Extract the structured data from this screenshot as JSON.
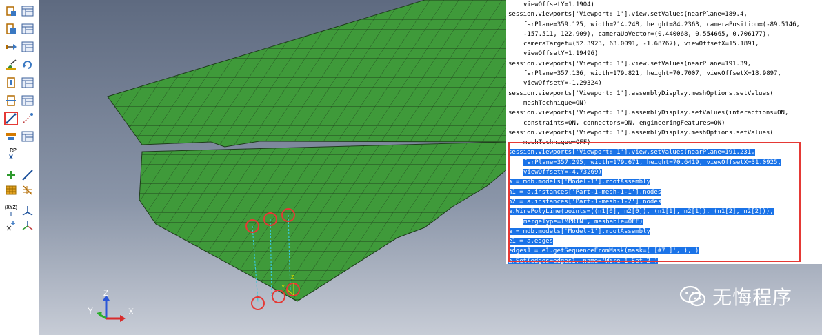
{
  "toolbox": {
    "icons": [
      "create-part-icon",
      "part-manager-icon",
      "create-instance-icon",
      "instance-manager-icon",
      "translate-instance-icon",
      "instance-manager-icon",
      "merge-cut-icon",
      "regenerate-icon",
      "feature-icon",
      "feature-manager-icon",
      "constraint-icon",
      "constraint-manager-icon",
      "create-wire-icon",
      "attachment-points-icon",
      "datum-icon",
      "datum-manager-icon",
      "reference-point-icon",
      "datum-point-icon",
      "datum-axis-icon",
      "datum-plane-icon",
      "partition-icon",
      "csys-icon",
      "datum-csys-icon",
      "mesh-edit-icon",
      "set-icon"
    ],
    "reference_point_label": "RP",
    "csys_label": "(XYZ)"
  },
  "console": {
    "lines": [
      {
        "text": "viewOffsetY=1.1904)",
        "indent": true,
        "hl": false
      },
      {
        "text": "session.viewports['Viewport: 1'].view.setValues(nearPlane=189.4,",
        "indent": false,
        "hl": false
      },
      {
        "text": "farPlane=359.125, width=214.248, height=84.2363, cameraPosition=(-89.5146,",
        "indent": true,
        "hl": false
      },
      {
        "text": "-157.511, 122.909), cameraUpVector=(0.440068, 0.554665, 0.706177),",
        "indent": true,
        "hl": false
      },
      {
        "text": "cameraTarget=(52.3923, 63.0091, -1.68767), viewOffsetX=15.1891,",
        "indent": true,
        "hl": false
      },
      {
        "text": "viewOffsetY=1.19496)",
        "indent": true,
        "hl": false
      },
      {
        "text": "session.viewports['Viewport: 1'].view.setValues(nearPlane=191.39,",
        "indent": false,
        "hl": false
      },
      {
        "text": "farPlane=357.136, width=179.821, height=70.7007, viewOffsetX=18.9897,",
        "indent": true,
        "hl": false
      },
      {
        "text": "viewOffsetY=-1.29324)",
        "indent": true,
        "hl": false
      },
      {
        "text": "session.viewports['Viewport: 1'].assemblyDisplay.meshOptions.setValues(",
        "indent": false,
        "hl": false
      },
      {
        "text": "meshTechnique=ON)",
        "indent": true,
        "hl": false
      },
      {
        "text": "session.viewports['Viewport: 1'].assemblyDisplay.setValues(interactions=ON,",
        "indent": false,
        "hl": false
      },
      {
        "text": "constraints=ON, connectors=ON, engineeringFeatures=ON)",
        "indent": true,
        "hl": false
      },
      {
        "text": "session.viewports['Viewport: 1'].assemblyDisplay.meshOptions.setValues(",
        "indent": false,
        "hl": false
      },
      {
        "text": "meshTechnique=OFF)",
        "indent": true,
        "hl": false
      },
      {
        "text": "session.viewports['Viewport: 1'].view.setValues(nearPlane=191.231,",
        "indent": false,
        "hl": true
      },
      {
        "text": "farPlane=357.295, width=179.671, height=70.6419, viewOffsetX=31.0925,",
        "indent": true,
        "hl": true
      },
      {
        "text": "viewOffsetY=-4.73269)",
        "indent": true,
        "hl": true
      },
      {
        "text": "a = mdb.models['Model-1'].rootAssembly",
        "indent": false,
        "hl": true
      },
      {
        "text": "n1 = a.instances['Part-1-mesh-1-1'].nodes",
        "indent": false,
        "hl": true
      },
      {
        "text": "n2 = a.instances['Part-1-mesh-1-2'].nodes",
        "indent": false,
        "hl": true
      },
      {
        "text": "a.WirePolyLine(points=((n1[0], n2[0]), (n1[1], n2[1]), (n1[2], n2[2])),",
        "indent": false,
        "hl": true
      },
      {
        "text": "mergeType=IMPRINT, meshable=OFF)",
        "indent": true,
        "hl": true
      },
      {
        "text": "a = mdb.models['Model-1'].rootAssembly",
        "indent": false,
        "hl": true
      },
      {
        "text": "e1 = a.edges",
        "indent": false,
        "hl": true
      },
      {
        "text": "edges1 = e1.getSequenceFromMask(mask=('[#7 ]', ), )",
        "indent": false,
        "hl": true
      },
      {
        "text": "a.Set(edges=edges1, name='Wire-1-Set-2')",
        "indent": false,
        "hl": true
      }
    ]
  },
  "triad": {
    "z": "Z",
    "y": "Y",
    "x": "X"
  },
  "local_axes": {
    "z": "Z",
    "y": "Y"
  },
  "watermark": {
    "text": "无悔程序"
  },
  "colors": {
    "mesh": "#3f9a3a",
    "mesh_line": "#1f3d1c",
    "highlight": "#1a73e8",
    "annotation_red": "#e53935",
    "wire": "#39c6d6"
  }
}
